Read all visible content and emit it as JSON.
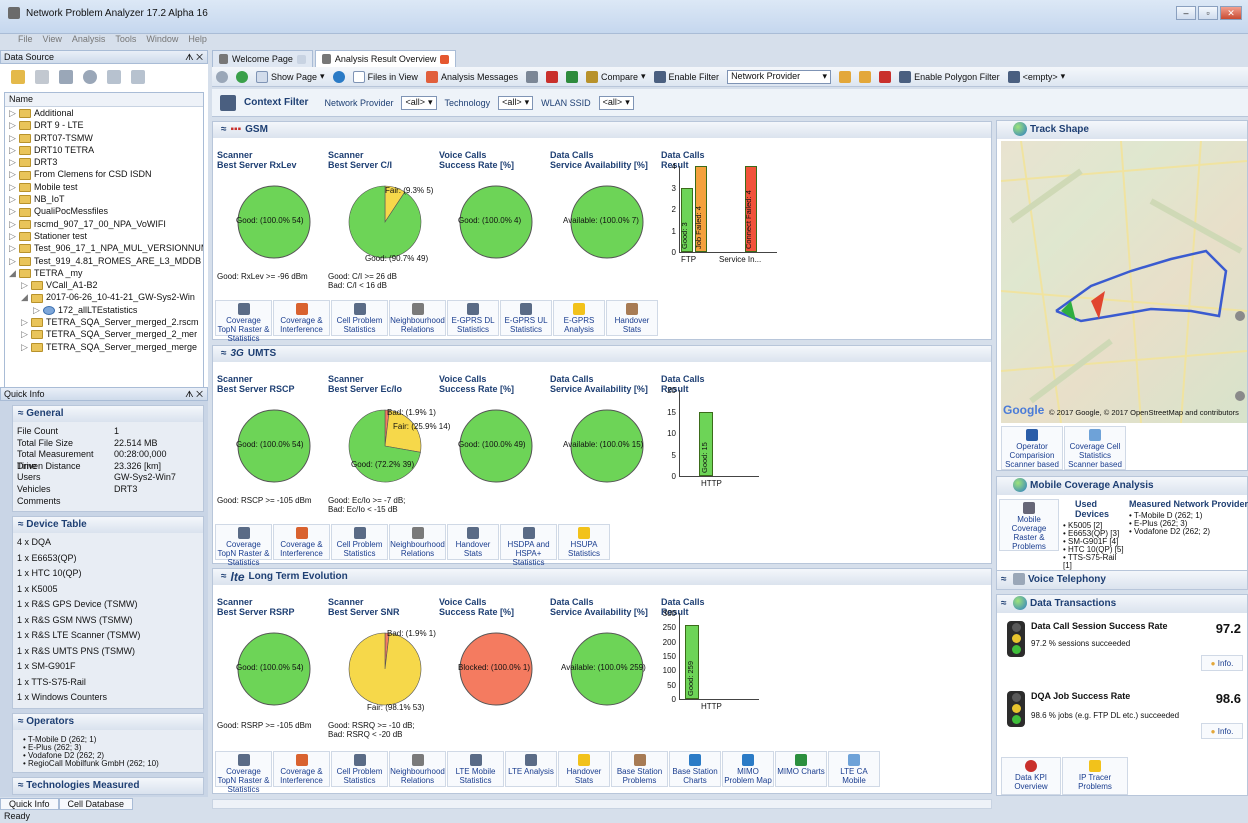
{
  "app": {
    "title": "Network Problem Analyzer 17.2 Alpha 16",
    "menu": [
      "File",
      "View",
      "Analysis",
      "Tools",
      "Window",
      "Help"
    ],
    "status": "Ready"
  },
  "left": {
    "data_source_title": "Data Source",
    "tree_header": "Name",
    "tree_items": [
      "Additional",
      "DRT 9 - LTE",
      "DRT07-TSMW",
      "DRT10 TETRA",
      "DRT3",
      "From Clemens for CSD ISDN",
      "Mobile test",
      "NB_IoT",
      "QualiPocMessfiles",
      "rscmd_907_17_00_NPA_VoWIFI",
      "Stationer test",
      "Test_906_17_1_NPA_MUL_VERSIONNUM",
      "Test_919_4.81_ROMES_ARE_L3_MDDB",
      "TETRA _my",
      "VCall_A1-B2",
      "2017-06-26_10-41-21_GW-Sys2-Win",
      "172_allLTEstatistics",
      "TETRA_SQA_Server_merged_2.rscm",
      "TETRA_SQA_Server_merged_2_mer",
      "TETRA_SQA_Server_merged_merge"
    ],
    "quick_info_title": "Quick Info",
    "general_title": "General",
    "general": [
      [
        "File Count",
        "1"
      ],
      [
        "Total File Size",
        "22.514 MB"
      ],
      [
        "Total Measurement Time",
        "00:28:00,000"
      ],
      [
        "Driven Distance",
        "23.326 [km]"
      ],
      [
        "Users",
        "GW-Sys2-Win7"
      ],
      [
        "Vehicles",
        "DRT3"
      ],
      [
        "Comments",
        ""
      ]
    ],
    "device_table_title": "Device Table",
    "devices": [
      "4 x DQA",
      "1 x E6653(QP)",
      "1 x HTC 10(QP)",
      "1 x K5005",
      "1 x R&S GPS Device (TSMW)",
      "1 x R&S GSM NWS (TSMW)",
      "1 x R&S LTE Scanner (TSMW)",
      "1 x R&S UMTS PNS (TSMW)",
      "1 x SM-G901F",
      "1 x TTS-S75-Rail",
      "1 x Windows Counters"
    ],
    "operators_title": "Operators",
    "operators": [
      "T-Mobile D (262; 1)",
      "E-Plus (262; 3)",
      "Vodafone D2 (262; 2)",
      "RegioCall Mobilfunk GmbH (262; 10)"
    ],
    "technologies_title": "Technologies Measured",
    "bottom_tabs": [
      "Quick Info",
      "Cell Database"
    ]
  },
  "tabs": [
    "Welcome Page",
    "Analysis Result Overview"
  ],
  "toolbar": {
    "show_page": "Show Page",
    "files_in_view": "Files in View",
    "analysis_messages": "Analysis Messages",
    "compare": "Compare",
    "enable_filter": "Enable Filter",
    "network_provider": "Network Provider",
    "enable_polygon": "Enable Polygon Filter",
    "empty": "<empty>"
  },
  "context": {
    "title": "Context Filter",
    "f1": "Network Provider",
    "f2": "Technology",
    "f3": "WLAN SSID",
    "all": "<all>"
  },
  "gsm": {
    "title": "GSM",
    "p1": "Scanner\nBest Server RxLev",
    "p2": "Scanner\nBest Server C/I",
    "p3": "Voice Calls\nSuccess Rate [%]",
    "p4": "Data Calls\nService Availability [%]",
    "p5": "Data Calls\nResult",
    "l1": "Good: (100.0% 54)",
    "l2a": "Fair: (9.3% 5)",
    "l2b": "Good: (90.7% 49)",
    "l3": "Good: (100.0% 4)",
    "l4": "Available: (100.0% 7)",
    "foot1": "Good: RxLev >= -96 dBm",
    "foot2": "Good: C/I >= 26 dB\nBad: C/I < 16 dB",
    "bars": {
      "yticks": [
        "4",
        "3",
        "2",
        "1",
        "0"
      ],
      "cats": [
        "FTP",
        "Service In..."
      ],
      "b1": "Good: 3",
      "b2": "Job Failed: 4",
      "b3": "Connect Failed: 4"
    },
    "buttons": [
      "Coverage TopN Raster & Statistics",
      "Coverage & Interference",
      "Cell Problem Statistics",
      "Neighbourhood Relations",
      "E-GPRS DL Statistics",
      "E-GPRS UL Statistics",
      "E-GPRS Analysis",
      "Handover Stats"
    ]
  },
  "umts": {
    "title": "UMTS",
    "p1": "Scanner\nBest Server RSCP",
    "p2": "Scanner\nBest Server Ec/Io",
    "p3": "Voice Calls\nSuccess Rate [%]",
    "p4": "Data Calls\nService Availability [%]",
    "p5": "Data Calls\nResult",
    "l1": "Good: (100.0% 54)",
    "l2a": "Bad: (1.9% 1)",
    "l2b": "Fair: (25.9% 14)",
    "l2c": "Good: (72.2% 39)",
    "l3": "Good: (100.0% 49)",
    "l4": "Available: (100.0% 15)",
    "foot1": "Good: RSCP >= -105 dBm",
    "foot2": "Good: Ec/Io >= -7 dB;\nBad: Ec/Io < -15 dB",
    "bars": {
      "yticks": [
        "20",
        "15",
        "10",
        "5",
        "0"
      ],
      "cats": [
        "HTTP"
      ],
      "b1": "Good: 15"
    },
    "buttons": [
      "Coverage TopN Raster & Statistics",
      "Coverage & Interference",
      "Cell Problem Statistics",
      "Neighbourhood Relations",
      "Handover Stats",
      "HSDPA and HSPA+ Statistics",
      "HSUPA Statistics"
    ]
  },
  "lte": {
    "title": "Long Term Evolution",
    "p1": "Scanner\nBest Server RSRP",
    "p2": "Scanner\nBest Server SNR",
    "p3": "Voice Calls\nSuccess Rate [%]",
    "p4": "Data Calls\nService Availability [%]",
    "p5": "Data Calls\nResult",
    "l1": "Good: (100.0% 54)",
    "l2a": "Bad: (1.9% 1)",
    "l2b": "Fair: (98.1% 53)",
    "l3": "Blocked: (100.0% 1)",
    "l4": "Available: (100.0% 259)",
    "foot1": "Good: RSRP >= -105 dBm",
    "foot2": "Good: RSRQ >= -10 dB;\nBad: RSRQ < -20 dB",
    "bars": {
      "yticks": [
        "300",
        "250",
        "200",
        "150",
        "100",
        "50",
        "0"
      ],
      "cats": [
        "HTTP"
      ],
      "b1": "Good: 259"
    },
    "buttons": [
      "Coverage TopN Raster & Statistics",
      "Coverage & Interference",
      "Cell Problem Statistics",
      "Neighbourhood Relations",
      "LTE Mobile Statistics",
      "LTE Analysis",
      "Handover Stats",
      "Base Station Problems",
      "Base Station Charts",
      "MIMO Problem Map",
      "MIMO Charts",
      "LTE CA Mobile"
    ]
  },
  "right": {
    "track_title": "Track Shape",
    "map_credit": "© 2017 Google, © 2017 OpenStreetMap and contributors",
    "track_buttons": [
      "Operator Comparision Scanner based",
      "Coverage Cell Statistics Scanner based"
    ],
    "mca_title": "Mobile Coverage Analysis",
    "used_devices_title": "Used Devices",
    "provider_title": "Measured Network Provider",
    "mca_button": "Mobile Coverage Raster & Problems",
    "used_devices": [
      "K5005 [2]",
      "E6653(QP) [3]",
      "SM-G901F [4]",
      "HTC 10(QP) [5]",
      "TTS-S75-Rail [1]"
    ],
    "providers": [
      "T-Mobile D (262; 1)",
      "E-Plus (262; 3)",
      "Vodafone D2 (262; 2)"
    ],
    "voice_title": "Voice Telephony",
    "data_title": "Data Transactions",
    "dt1_title": "Data Call Session Success Rate",
    "dt1_value": "97.2",
    "dt1_desc": "97.2 % sessions succeeded",
    "dt2_title": "DQA Job Success Rate",
    "dt2_value": "98.6",
    "dt2_desc": "98.6 % jobs (e.g. FTP DL etc.) succeeded",
    "info": "Info.",
    "bottom_buttons": [
      "Data KPI Overview",
      "IP Tracer Problems"
    ]
  }
}
